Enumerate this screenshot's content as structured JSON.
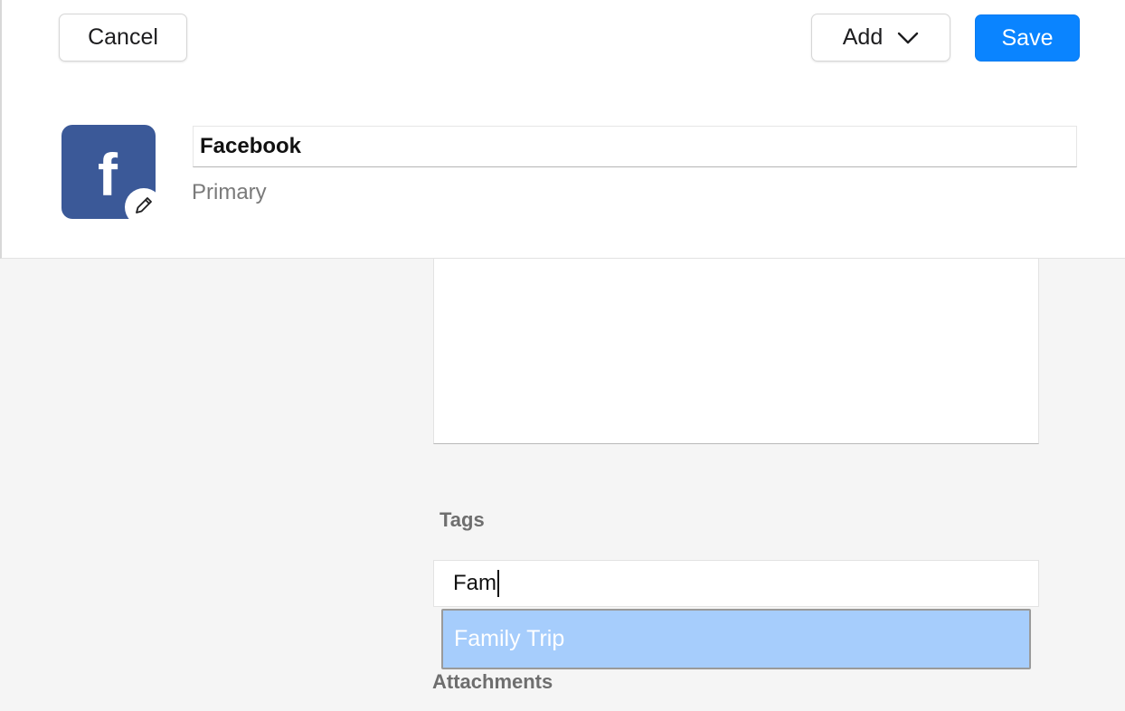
{
  "toolbar": {
    "cancel_label": "Cancel",
    "add_label": "Add",
    "save_label": "Save"
  },
  "account": {
    "logo_letter": "f",
    "logo_color": "#3b5998",
    "logo_icon": "facebook-logo",
    "edit_icon": "pencil-icon",
    "title": "Facebook",
    "subtitle": "Primary"
  },
  "notes": {
    "value": ""
  },
  "tags": {
    "label": "Tags",
    "input_value": "Fam",
    "suggestions": [
      "Family Trip"
    ]
  },
  "attachments": {
    "label": "Attachments"
  },
  "colors": {
    "accent": "#0a84ff",
    "suggestion_highlight": "#a6cdfc"
  }
}
